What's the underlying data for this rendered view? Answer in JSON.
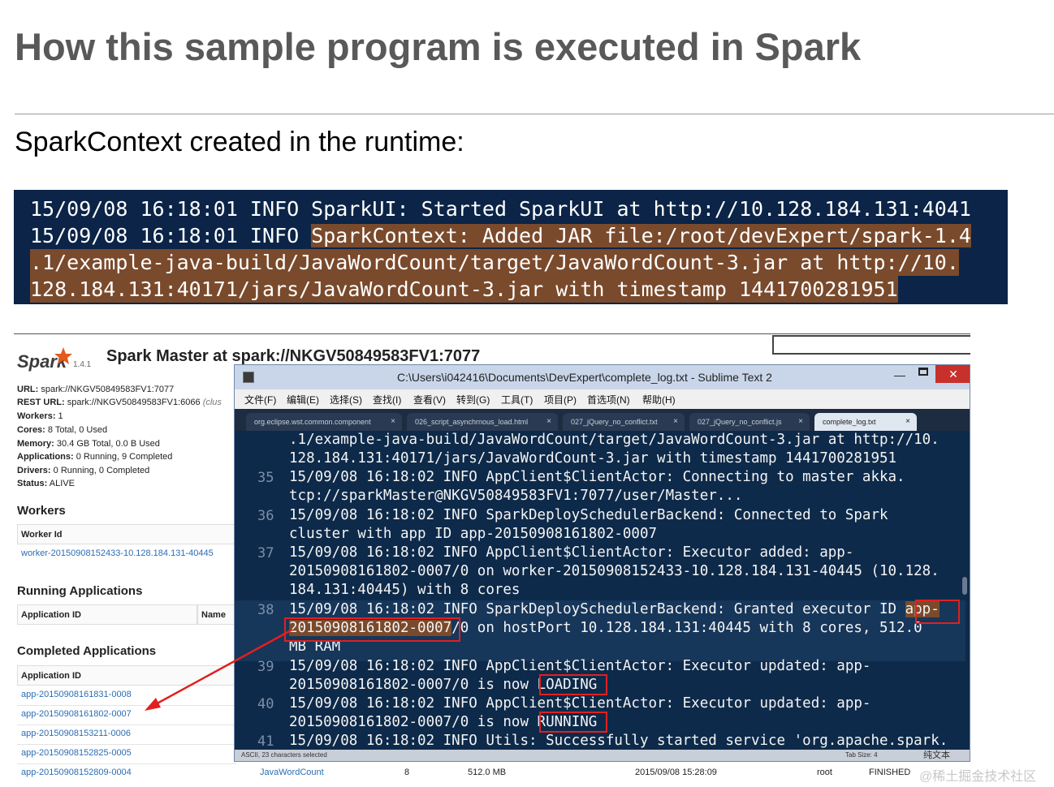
{
  "slide": {
    "title": "How this sample program is executed in Spark",
    "subtitle": "SparkContext created in the runtime:"
  },
  "console": {
    "lines": [
      "15/09/08 16:18:01 INFO SparkUI: Started SparkUI at http://10.128.184.131:4041",
      "15/09/08 16:18:01 INFO ",
      "SparkContext: Added JAR file:/root/devExpert/spark-1.4",
      ".1/example-java-build/JavaWordCount/target/JavaWordCount-3.jar at http://10.",
      "128.184.131:40171/jars/JavaWordCount-3.jar with timestamp 1441700281951"
    ]
  },
  "spark_master": {
    "logo_text": "Spark",
    "version": "1.4.1",
    "heading": "Spark Master at spark://NKGV50849583FV1:7077",
    "info": [
      {
        "label": "URL:",
        "value": "spark://NKGV50849583FV1:7077"
      },
      {
        "label": "REST URL:",
        "value": "spark://NKGV50849583FV1:6066",
        "extra": "(clus"
      },
      {
        "label": "Workers:",
        "value": "1"
      },
      {
        "label": "Cores:",
        "value": "8 Total, 0 Used"
      },
      {
        "label": "Memory:",
        "value": "30.4 GB Total, 0.0 B Used"
      },
      {
        "label": "Applications:",
        "value": "0 Running, 9 Completed"
      },
      {
        "label": "Drivers:",
        "value": "0 Running, 0 Completed"
      },
      {
        "label": "Status:",
        "value": "ALIVE"
      }
    ],
    "workers": {
      "heading": "Workers",
      "column": "Worker Id",
      "row": "worker-20150908152433-10.128.184.131-40445"
    },
    "running": {
      "heading": "Running Applications",
      "columns": [
        "Application ID",
        "Name"
      ]
    },
    "completed": {
      "heading": "Completed Applications",
      "column": "Application ID",
      "rows": [
        "app-20150908161831-0008",
        "app-20150908161802-0007",
        "app-20150908153211-0006",
        "app-20150908152825-0005",
        "app-20150908152809-0004"
      ],
      "last_row": {
        "name": "JavaWordCount",
        "cores": "8",
        "memory": "512.0 MB",
        "submitted": "2015/09/08 15:28:09",
        "user": "root",
        "state": "FINISHED"
      }
    }
  },
  "sublime": {
    "title": "C:\\Users\\i042416\\Documents\\DevExpert\\complete_log.txt - Sublime Text 2",
    "close": "✕",
    "minimize": "—",
    "menu": [
      "文件(F)",
      "编辑(E)",
      "选择(S)",
      "查找(I)",
      "查看(V)",
      "转到(G)",
      "工具(T)",
      "项目(P)",
      "首选项(N)",
      "帮助(H)"
    ],
    "tabs": [
      {
        "label": "org.eclipse.wst.common.component",
        "close": "×"
      },
      {
        "label": "026_script_asynchrnous_load.html",
        "close": "×"
      },
      {
        "label": "027_jQuery_no_conflict.txt",
        "close": "×"
      },
      {
        "label": "027_jQuery_no_conflict.js",
        "close": "×"
      },
      {
        "label": "complete_log.txt",
        "close": "×"
      }
    ],
    "gutter": [
      "35",
      "36",
      "37",
      "38",
      "39",
      "40",
      "41"
    ],
    "lines": [
      ".1/example-java-build/JavaWordCount/target/JavaWordCount-3.jar at http://10.",
      "128.184.131:40171/jars/JavaWordCount-3.jar with timestamp 1441700281951",
      "15/09/08 16:18:02 INFO AppClient$ClientActor: Connecting to master akka.",
      "tcp://sparkMaster@NKGV50849583FV1:7077/user/Master...",
      "15/09/08 16:18:02 INFO SparkDeploySchedulerBackend: Connected to Spark",
      "cluster with app ID app-20150908161802-0007",
      "15/09/08 16:18:02 INFO AppClient$ClientActor: Executor added: app-",
      "20150908161802-0007/0 on worker-20150908152433-10.128.184.131-40445 (10.128.",
      "184.131:40445) with 8 cores",
      "15/09/08 16:18:02 INFO SparkDeploySchedulerBackend: Granted executor ID ",
      "app-",
      "20150908161802-0007",
      "/0 on hostPort 10.128.184.131:40445 with 8 cores, 512.0",
      "MB RAM",
      "15/09/08 16:18:02 INFO AppClient$ClientActor: Executor updated: app-",
      "20150908161802-0007/0 is now ",
      "LOADING",
      "15/09/08 16:18:02 INFO AppClient$ClientActor: Executor updated: app-",
      "20150908161802-0007/0 is now ",
      "RUNNING",
      "15/09/08 16:18:02 INFO Utils: Successfully started service 'org.apache.spark."
    ],
    "status_left": "ASCII, 23 characters selected",
    "status_right": "Tab Size: 4",
    "status_right2": "纯文本"
  },
  "watermark": "@稀土掘金技术社区",
  "colors": {
    "console_bg": "#0b2447",
    "selection": "#7a4a2c",
    "annotation_red": "#e02020",
    "link_blue": "#2a6db4"
  }
}
